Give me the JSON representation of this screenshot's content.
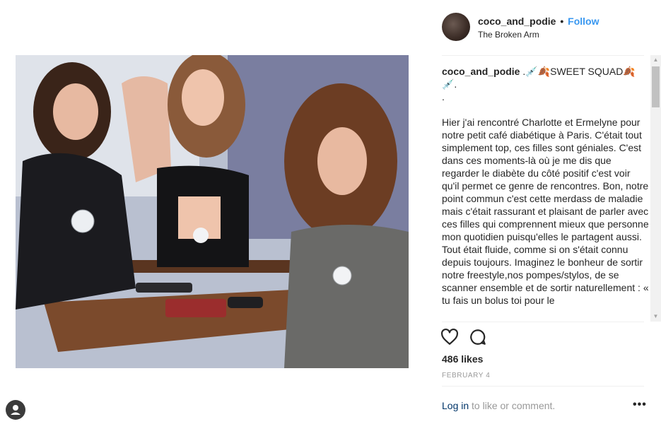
{
  "post": {
    "photo_alt": "",
    "header": {
      "username": "coco_and_podie",
      "separator": "•",
      "follow_label": "Follow",
      "location": "The Broken Arm"
    },
    "caption": {
      "author": "coco_and_podie",
      "text": " .💉🍂SWEET SQUAD🍂\n💉.\n.\n\nHier j'ai rencontré Charlotte et Ermelyne pour notre petit café diabétique à Paris. C'était tout simplement top, ces filles sont géniales. C'est dans ces moments-là où je me dis que regarder le diabète du côté positif c'est voir qu'il permet ce genre de rencontres. Bon, notre point commun c'est cette merdass de maladie mais c'était rassurant et plaisant de parler avec ces filles qui comprennent mieux que personne mon quotidien puisqu'elles le partagent aussi. Tout était fluide, comme si on s'était connu depuis toujours. Imaginez le bonheur de sortir notre freestyle,nos pompes/stylos, de se scanner ensemble et de sortir naturellement : « tu fais un bolus toi pour le"
    },
    "likes": "486 likes",
    "date": "FEBRUARY 4",
    "login": {
      "link_label": "Log in",
      "suffix": " to like or comment."
    },
    "more_label": "•••"
  }
}
